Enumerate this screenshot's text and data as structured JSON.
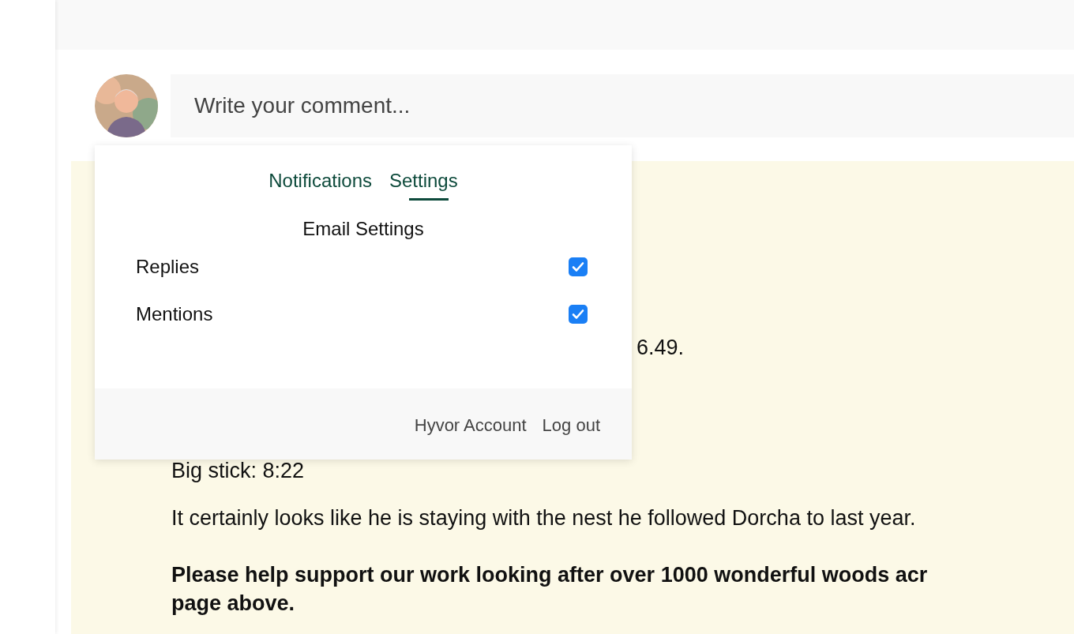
{
  "composer": {
    "placeholder": "Write your comment..."
  },
  "comment": {
    "paragraphs": [
      {
        "text": "6.49.",
        "bold": false
      },
      {
        "text": "Big stick: 8:22",
        "bold": false
      },
      {
        "text": "It certainly looks like he is staying with the nest he followed Dorcha to last year.",
        "bold": false
      },
      {
        "text": "Please help support our work looking after over 1000 wonderful woods acr\npage above.",
        "bold": true
      }
    ]
  },
  "dropdown": {
    "tabs": [
      {
        "label": "Notifications",
        "selected": false
      },
      {
        "label": "Settings",
        "selected": true
      }
    ],
    "heading": "Email Settings",
    "options": [
      {
        "label": "Replies",
        "checked": true
      },
      {
        "label": "Mentions",
        "checked": true
      }
    ],
    "footer_links": [
      "Hyvor Account",
      "Log out"
    ]
  }
}
